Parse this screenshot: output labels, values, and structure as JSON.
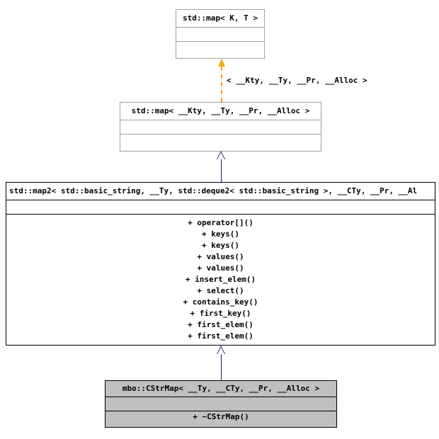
{
  "diagram": {
    "kind": "uml-class-inheritance-diagram",
    "background_color": "#ffffff"
  },
  "classes": {
    "base_template": {
      "title": "std::map< K, T >",
      "attributes": [],
      "operations": []
    },
    "instantiated_map": {
      "title": "std::map< __Kty, __Ty, __Pr, __Alloc >",
      "attributes": [],
      "operations": []
    },
    "map2": {
      "title": "std::map2< std::basic_string, __Ty, std::deque2< std::basic_string >, __CTy, __Pr, __Al",
      "attributes": [],
      "operations": [
        "+ operator[]()",
        "+ keys()",
        "+ keys()",
        "+ values()",
        "+ values()",
        "+ insert_elem()",
        "+ select()",
        "+ contains_key()",
        "+ first_key()",
        "+ first_elem()",
        "+ first_elem()"
      ]
    },
    "cstrmap": {
      "title": "mbo::CStrMap< __Ty, __CTy, __Pr, __Alloc >",
      "attributes": [],
      "operations": [
        "+ ~CStrMap()"
      ]
    }
  },
  "edges": {
    "template_binding": {
      "label": "< __Kty, __Ty, __Pr, __Alloc >",
      "style": "dashed",
      "color": "#f7a70a",
      "arrowhead": "filled-triangle"
    },
    "inheritance_map_to_map2": {
      "label": "",
      "style": "solid",
      "color": "#1a1a6e",
      "arrowhead": "hollow-triangle"
    },
    "inheritance_map2_to_cstrmap": {
      "label": "",
      "style": "solid",
      "color": "#1a1a6e",
      "arrowhead": "hollow-triangle"
    }
  },
  "colors": {
    "box_border_grey": "#a0a0a0",
    "box_border_black": "#000000",
    "box_fill_white": "#ffffff",
    "box_fill_grey": "#c0c0c0",
    "edge_navy": "#1a1a6e",
    "edge_orange": "#f7a70a"
  }
}
